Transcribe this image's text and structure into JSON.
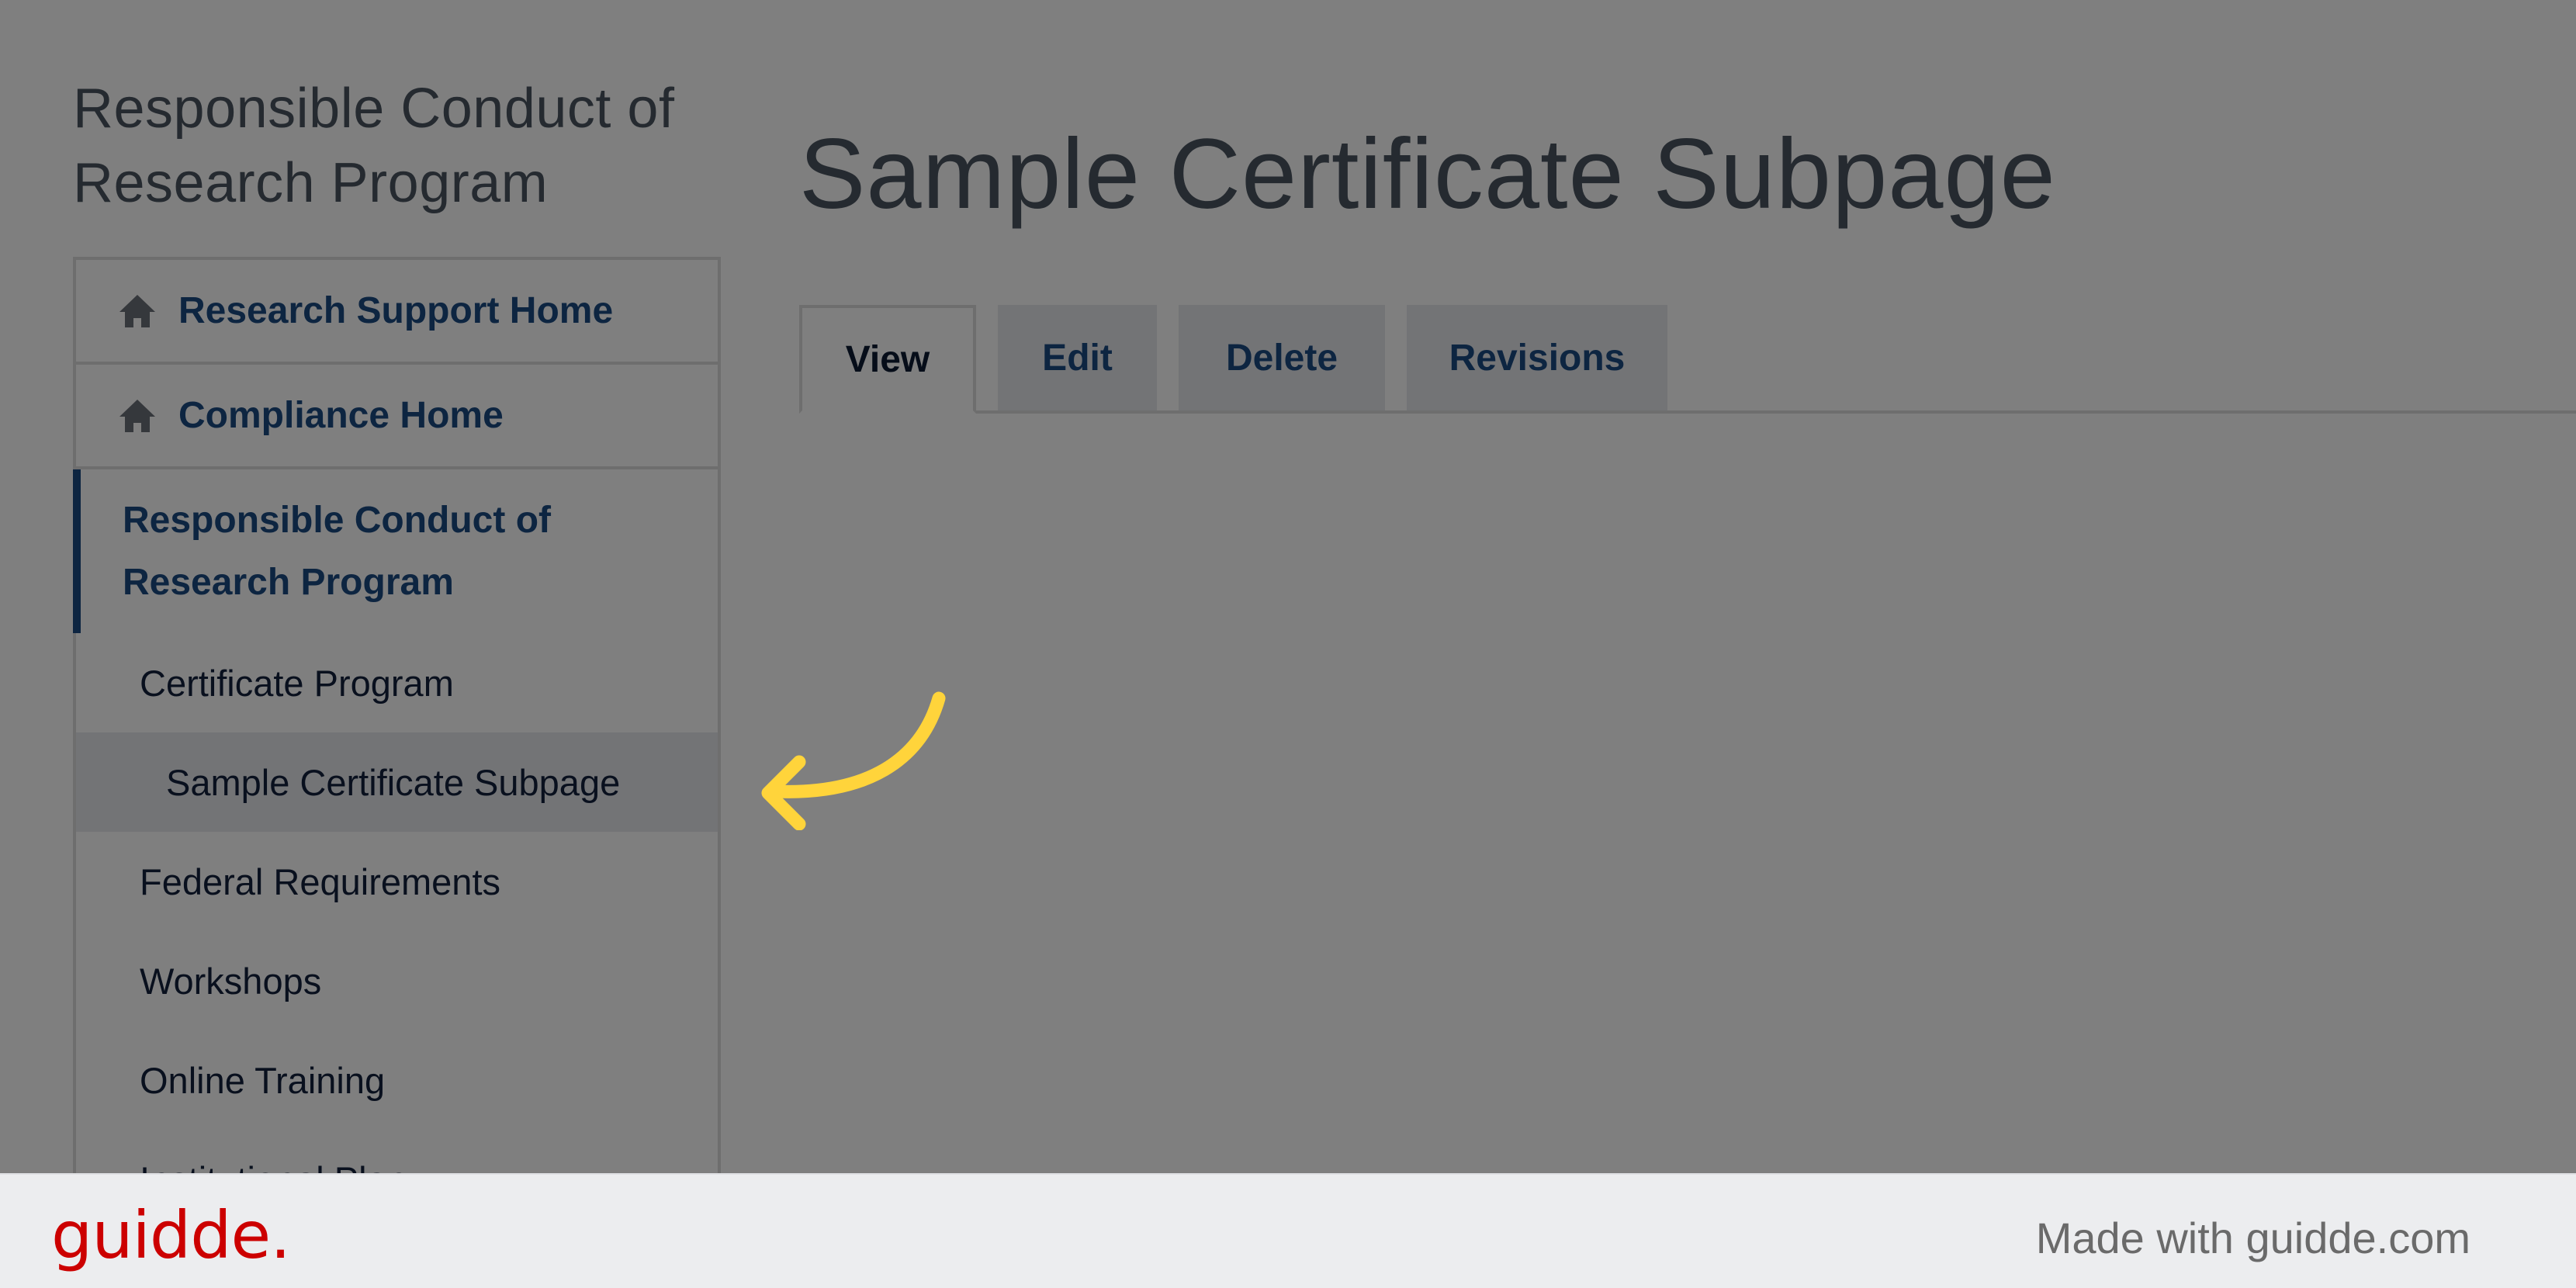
{
  "sidebar": {
    "title_line1": "Responsible Conduct of",
    "title_line2": "Research Program",
    "items": [
      {
        "label": "Research Support Home",
        "icon": "home-icon",
        "level": "top"
      },
      {
        "label": "Compliance Home",
        "icon": "home-icon",
        "level": "top"
      },
      {
        "label_line1": "Responsible Conduct of",
        "label_line2": "Research Program",
        "level": "active-parent"
      },
      {
        "label": "Certificate Program",
        "level": "child"
      },
      {
        "label": "Sample Certificate Subpage",
        "level": "grandchild",
        "selected": true
      },
      {
        "label": "Federal Requirements",
        "level": "child"
      },
      {
        "label": "Workshops",
        "level": "child"
      },
      {
        "label": "Online Training",
        "level": "child"
      },
      {
        "label": "Institutional Plan",
        "level": "child"
      }
    ]
  },
  "main": {
    "title": "Sample Certificate Subpage",
    "tabs": [
      {
        "label": "View",
        "active": true
      },
      {
        "label": "Edit"
      },
      {
        "label": "Delete"
      },
      {
        "label": "Revisions"
      }
    ]
  },
  "annotation": {
    "type": "curved-arrow",
    "color": "#ffd43b"
  },
  "footer": {
    "logo": "guidde.",
    "credit": "Made with guidde.com",
    "logo_color": "#cc0000"
  },
  "colors": {
    "link": "#1b4a82",
    "overlay": "rgba(0,0,0,0.5)",
    "footer_bg": "#ecedef"
  }
}
